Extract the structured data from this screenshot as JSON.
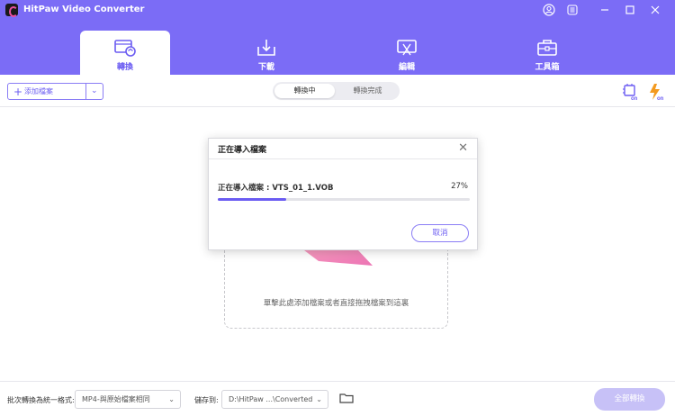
{
  "app": {
    "title": "HitPaw Video Converter"
  },
  "tabs": [
    {
      "label": "轉換"
    },
    {
      "label": "下載"
    },
    {
      "label": "編輯"
    },
    {
      "label": "工具箱"
    }
  ],
  "toolbar": {
    "add_files_label": "添加檔案",
    "segments": [
      "轉換中",
      "轉換完成"
    ],
    "hw_accel_label": "on",
    "turbo_label": "on"
  },
  "dropzone": {
    "hint": "單擊此處添加檔案或者直接拖拽檔案到這裏"
  },
  "dialog": {
    "title": "正在導入檔案",
    "file_label": "正在導入檔案 : VTS_01_1.VOB",
    "progress_text": "27%",
    "progress_value": 0.27,
    "cancel_label": "取消"
  },
  "bottom": {
    "format_label": "批次轉換為統一格式:",
    "format_value": "MP4-與原始檔案相同",
    "save_label": "儲存到:",
    "save_value": "D:\\HitPaw ...\\Converted",
    "convert_all_label": "全部轉換"
  },
  "colors": {
    "accent": "#7b6cf6",
    "accent_dark": "#6b5cf2",
    "disabled_button": "#c7c1f7"
  }
}
